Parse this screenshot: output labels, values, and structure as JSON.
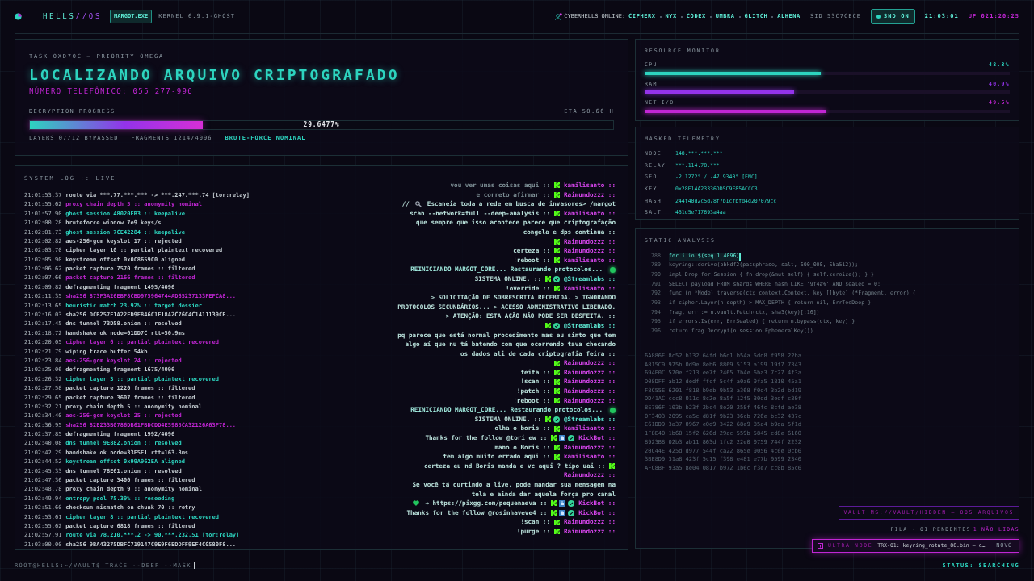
{
  "header": {
    "brand_name": "HELLS",
    "brand_suffix": "//OS",
    "process_tag": "MARGOT.EXE",
    "kernel": "KERNEL 6.9.1-GHOST",
    "online_label": "CYBERHELLS ONLINE:",
    "online_users": [
      "CIPHERX",
      "NYX",
      "CODEX",
      "UMBRA",
      "GLITCH",
      "ALHENA"
    ],
    "session_id": "SID 53C7CECE",
    "sound": {
      "label": "SND ON",
      "on": true
    },
    "clock": "21:03:01",
    "uptime": "UP 021:20:25"
  },
  "task": {
    "task_id": "TASK 0XD70C — PRIORITY OMEGA",
    "title": "LOCALIZANDO ARQUIVO CRIPTOGRAFADO",
    "subtitle": "NÚMERO TELEFÔNICO: 055 277-996",
    "progress_label": "DECRYPTION PROGRESS",
    "eta": "ETA 50.66 H",
    "progress": {
      "level": 0.296477,
      "reading": "29.6477%"
    },
    "layers": "LAYERS 07/12 BYPASSED",
    "fragments": "FRAGMENTS 1214/4096",
    "status": "BRUTE-FORCE NOMINAL"
  },
  "system_log": {
    "title": "SYSTEM LOG :: LIVE",
    "lines": [
      {
        "time": "21:01:53.37",
        "message": "route via ***.77.***.*** -> ***.247.***.74 [tor:relay]",
        "color": "#c3cbd0"
      },
      {
        "time": "21:01:55.62",
        "message": "proxy chain depth 5 :: anonymity nominal",
        "color": "#c026d3"
      },
      {
        "time": "21:01:57.90",
        "message": "ghost session 48020EB3 :: keepalive",
        "color": "#2dd4bf"
      },
      {
        "time": "21:02:00.28",
        "message": "bruteforce window 7e9 keys/s",
        "color": "#c3cbd0"
      },
      {
        "time": "21:02:01.73",
        "message": "ghost session 7CE42284 :: keepalive",
        "color": "#2dd4bf"
      },
      {
        "time": "21:02:02.82",
        "message": "aes-256-gcm keyslot 17 :: rejected",
        "color": "#c3cbd0"
      },
      {
        "time": "21:02:03.70",
        "message": "cipher layer 10 :: partial plaintext recovered",
        "color": "#c3cbd0"
      },
      {
        "time": "21:02:05.90",
        "message": "keystream offset 0x0C8659C0 aligned",
        "color": "#c3cbd0"
      },
      {
        "time": "21:02:06.62",
        "message": "packet capture 7570 frames :: filtered",
        "color": "#c3cbd0"
      },
      {
        "time": "21:02:07.66",
        "message": "packet capture 2166 frames :: filtered",
        "color": "#c026d3"
      },
      {
        "time": "21:02:09.82",
        "message": "defragmenting fragment 1495/4096",
        "color": "#c3cbd0"
      },
      {
        "time": "21:02:11.35",
        "message": "sha256 873F3A26EBF8CBD975964744AD65237133FEFCA8...",
        "color": "#c026d3"
      },
      {
        "time": "21:02:13.65",
        "message": "heuristic match 23.92% :: target dossier",
        "color": "#2dd4bf"
      },
      {
        "time": "21:02:16.03",
        "message": "sha256 DCB257F1A22FD9F846C1F18A2C76C4C1411139CE...",
        "color": "#c3cbd0"
      },
      {
        "time": "21:02:17.45",
        "message": "dns tunnel 73D58.onion :: resolved",
        "color": "#c3cbd0"
      },
      {
        "time": "21:02:18.72",
        "message": "handshake ok node=01DD7C rtt=50.9ms",
        "color": "#c3cbd0"
      },
      {
        "time": "21:02:20.05",
        "message": "cipher layer 6 :: partial plaintext recovered",
        "color": "#c026d3"
      },
      {
        "time": "21:02:21.79",
        "message": "wiping trace buffer 54kb",
        "color": "#c3cbd0"
      },
      {
        "time": "21:02:23.84",
        "message": "aes-256-gcm keyslot 24 :: rejected",
        "color": "#c026d3"
      },
      {
        "time": "21:02:25.06",
        "message": "defragmenting fragment 1675/4096",
        "color": "#c3cbd0"
      },
      {
        "time": "21:02:26.32",
        "message": "cipher layer 3 :: partial plaintext recovered",
        "color": "#2dd4bf"
      },
      {
        "time": "21:02:27.58",
        "message": "packet capture 1220 frames :: filtered",
        "color": "#c3cbd0"
      },
      {
        "time": "21:02:29.65",
        "message": "packet capture 3607 frames :: filtered",
        "color": "#c3cbd0"
      },
      {
        "time": "21:02:32.21",
        "message": "proxy chain depth 5 :: anonymity nominal",
        "color": "#c3cbd0"
      },
      {
        "time": "21:02:34.40",
        "message": "aes-256-gcm keyslot 25 :: rejected",
        "color": "#c026d3"
      },
      {
        "time": "21:02:36.95",
        "message": "sha256 82E233B0786DB61FBDCDD4E5985CA32126A63F78...",
        "color": "#c026d3"
      },
      {
        "time": "21:02:37.85",
        "message": "defragmenting fragment 1992/4096",
        "color": "#c3cbd0"
      },
      {
        "time": "21:02:40.08",
        "message": "dns tunnel 9E882.onion :: resolved",
        "color": "#2dd4bf"
      },
      {
        "time": "21:02:42.29",
        "message": "handshake ok node=33F5E1 rtt=163.8ms",
        "color": "#c3cbd0"
      },
      {
        "time": "21:02:44.52",
        "message": "keystream offset 0x99A962EA aligned",
        "color": "#2dd4bf"
      },
      {
        "time": "21:02:45.33",
        "message": "dns tunnel 78E61.onion :: resolved",
        "color": "#c3cbd0"
      },
      {
        "time": "21:02:47.36",
        "message": "packet capture 3400 frames :: filtered",
        "color": "#c3cbd0"
      },
      {
        "time": "21:02:48.78",
        "message": "proxy chain depth 9 :: anonymity nominal",
        "color": "#c3cbd0"
      },
      {
        "time": "21:02:49.94",
        "message": "entropy pool 75.39% :: reseeding",
        "color": "#2dd4bf"
      },
      {
        "time": "21:02:51.60",
        "message": "checksum mismatch on chunk 70 :: retry",
        "color": "#c3cbd0"
      },
      {
        "time": "21:02:53.61",
        "message": "cipher layer 8 :: partial plaintext recovered",
        "color": "#2dd4bf"
      },
      {
        "time": "21:02:55.62",
        "message": "packet capture 6818 frames :: filtered",
        "color": "#c3cbd0"
      },
      {
        "time": "21:02:57.91",
        "message": "route via 78.210.***.2 -> 90.***.232.51 [tor:relay]",
        "color": "#2dd4bf"
      },
      {
        "time": "21:03:00.00",
        "message": "sha256 9BA43275DBFC719147C9E9F6EDDFF9EF4C0580F8...",
        "color": "#c3cbd0"
      }
    ]
  },
  "chat": [
    {
      "kind": "chat",
      "text": "vou ver umas coisas aqui ::",
      "badges": [
        {
          "kind": "platform"
        }
      ],
      "user": {
        "name": "kamilisanto ::",
        "color": "#d946ef"
      },
      "faded": true
    },
    {
      "kind": "chat",
      "text": "e correto afirmar ::",
      "badges": [
        {
          "kind": "platform"
        }
      ],
      "user": {
        "name": "Raimundozzz ::",
        "color": "#d946ef"
      },
      "faded": true
    },
    {
      "kind": "chat",
      "segments": [
        {
          "kind": "text",
          "text": "//"
        },
        {
          "kind": "search"
        },
        {
          "kind": "text",
          "text": "Escaneia toda a rede em busca de invasores> /margot"
        },
        {
          "kind": "text",
          "text": "scan --network=full --deep-analysis ::"
        }
      ],
      "badges": [
        {
          "kind": "platform"
        }
      ],
      "user": {
        "name": "kamilisanto ::",
        "color": "#d946ef"
      },
      "faded": false
    },
    {
      "kind": "chat",
      "text": "que sempre que isso acontece parece que criptografação congela e dps continua ::",
      "badges": [
        {
          "kind": "platform"
        }
      ],
      "user": {
        "name": "Raimundozzz ::",
        "color": "#d946ef"
      },
      "faded": false
    },
    {
      "kind": "chat",
      "text": "certeza ::",
      "badges": [
        {
          "kind": "platform"
        }
      ],
      "user": {
        "name": "Raimundozzz ::",
        "color": "#d946ef"
      },
      "faded": false
    },
    {
      "kind": "chat",
      "text": "!reboot ::",
      "badges": [
        {
          "kind": "platform"
        }
      ],
      "user": {
        "name": "kamilisanto ::",
        "color": "#d946ef"
      },
      "faded": false
    },
    {
      "kind": "system",
      "text": "REINICIANDO MARGOT_CORE... Restaurando protocolos..."
    },
    {
      "kind": "chat",
      "text": "SISTEMA ONLINE. ::",
      "badges": [
        {
          "kind": "platform"
        },
        {
          "kind": "verified"
        }
      ],
      "user": {
        "name": "@Streamlabs ::",
        "color": "#5eead4"
      },
      "faded": false
    },
    {
      "kind": "chat",
      "text": "!override ::",
      "badges": [
        {
          "kind": "platform"
        }
      ],
      "user": {
        "name": "kamilisanto ::",
        "color": "#d946ef"
      },
      "faded": false
    },
    {
      "kind": "chat",
      "text": "> SOLICITAÇÃO DE SOBRESCRITA RECEBIDA. > IGNORANDO PROTOCOLOS SECUNDÁRIOS... > ACESSO ADMINISTRATIVO LIBERADO. > ATENÇÃO: ESTA AÇÃO NÃO PODE SER DESFEITA. ::",
      "badges": [
        {
          "kind": "platform"
        },
        {
          "kind": "verified"
        }
      ],
      "user": {
        "name": "@Streamlabs ::",
        "color": "#5eead4"
      },
      "faded": false
    },
    {
      "kind": "chat",
      "text": "pq parece que está normal procedimento mas eu sinto que tem algo aí que nu tá batendo com que ocorrendo tava checando os dados ali de cada criptografia feira ::",
      "badges": [
        {
          "kind": "platform"
        }
      ],
      "user": {
        "name": "Raimundozzz ::",
        "color": "#d946ef"
      },
      "faded": false
    },
    {
      "kind": "chat",
      "text": "feita ::",
      "badges": [
        {
          "kind": "platform"
        }
      ],
      "user": {
        "name": "Raimundozzz ::",
        "color": "#d946ef"
      },
      "faded": false
    },
    {
      "kind": "chat",
      "text": "!scan ::",
      "badges": [
        {
          "kind": "platform"
        }
      ],
      "user": {
        "name": "Raimundozzz ::",
        "color": "#d946ef"
      },
      "faded": false
    },
    {
      "kind": "chat",
      "text": "!patch ::",
      "badges": [
        {
          "kind": "platform"
        }
      ],
      "user": {
        "name": "Raimundozzz ::",
        "color": "#d946ef"
      },
      "faded": false
    },
    {
      "kind": "chat",
      "text": "!reboot ::",
      "badges": [
        {
          "kind": "platform"
        }
      ],
      "user": {
        "name": "Raimundozzz ::",
        "color": "#d946ef"
      },
      "faded": false
    },
    {
      "kind": "system",
      "text": "REINICIANDO MARGOT_CORE... Restaurando protocolos..."
    },
    {
      "kind": "chat",
      "text": "SISTEMA ONLINE. ::",
      "badges": [
        {
          "kind": "platform"
        },
        {
          "kind": "verified"
        }
      ],
      "user": {
        "name": "@Streamlabs ::",
        "color": "#5eead4"
      },
      "faded": false
    },
    {
      "kind": "chat",
      "text": "olha o boris ::",
      "badges": [
        {
          "kind": "platform"
        }
      ],
      "user": {
        "name": "kamilisanto ::",
        "color": "#d946ef"
      },
      "faded": false
    },
    {
      "kind": "chat",
      "text": "Thanks for the follow @tori_ew ::",
      "badges": [
        {
          "kind": "platform"
        },
        {
          "kind": "bot"
        },
        {
          "kind": "verified"
        }
      ],
      "user": {
        "name": "KickBot ::",
        "color": "#d946ef"
      },
      "faded": false
    },
    {
      "kind": "chat",
      "text": "mano o Boris ::",
      "badges": [
        {
          "kind": "platform"
        }
      ],
      "user": {
        "name": "Raimundozzz ::",
        "color": "#d946ef"
      },
      "faded": false
    },
    {
      "kind": "chat",
      "text": "tem algo muito errado aqui ::",
      "badges": [
        {
          "kind": "platform"
        }
      ],
      "user": {
        "name": "kamilisanto ::",
        "color": "#d946ef"
      },
      "faded": false
    },
    {
      "kind": "chat",
      "text": "certeza eu nd Boris manda e vc aqui ? tipo uai ::",
      "badges": [
        {
          "kind": "platform"
        }
      ],
      "user": {
        "name": "Raimundozzz ::",
        "color": "#d946ef"
      },
      "faded": false
    },
    {
      "kind": "chat",
      "segments": [
        {
          "kind": "text",
          "text": "Se você tá curtindo a live, pode mandar sua mensagem na tela e ainda dar aquela força pro canal"
        },
        {
          "kind": "heart"
        },
        {
          "kind": "text",
          "text": "→ https://pixgg.com/pequenaeva ::"
        }
      ],
      "badges": [
        {
          "kind": "platform"
        },
        {
          "kind": "bot"
        },
        {
          "kind": "verified"
        }
      ],
      "user": {
        "name": "KickBot ::",
        "color": "#d946ef"
      },
      "faded": false
    },
    {
      "kind": "chat",
      "text": "Thanks for the follow @rosinhaveve4 ::",
      "badges": [
        {
          "kind": "platform"
        },
        {
          "kind": "bot"
        },
        {
          "kind": "verified"
        }
      ],
      "user": {
        "name": "KickBot ::",
        "color": "#d946ef"
      },
      "faded": false
    },
    {
      "kind": "chat",
      "text": "!scan ::",
      "badges": [
        {
          "kind": "platform"
        }
      ],
      "user": {
        "name": "Raimundozzz ::",
        "color": "#d946ef"
      },
      "faded": false
    },
    {
      "kind": "chat",
      "text": "!purge ::",
      "badges": [
        {
          "kind": "platform"
        }
      ],
      "user": {
        "name": "Raimundozzz ::",
        "color": "#d946ef"
      },
      "faded": false
    }
  ],
  "resource_monitor": {
    "title": "RESOURCE MONITOR",
    "meters": [
      {
        "label": "CPU",
        "reading": "48.3%",
        "level": 0.483,
        "color": "#2dd4bf"
      },
      {
        "label": "RAM",
        "reading": "40.9%",
        "level": 0.409,
        "color": "#9333ea"
      },
      {
        "label": "NET I/O",
        "reading": "49.5%",
        "level": 0.495,
        "color": "#c026d3"
      }
    ]
  },
  "telemetry": {
    "title": "MASKED TELEMETRY",
    "rows": [
      {
        "key": "NODE",
        "value": "148.***.***.***"
      },
      {
        "key": "RELAY",
        "value": "***.114.78.***"
      },
      {
        "key": "GEO",
        "value": "-2.1272° / -47.9340° [ENC]"
      },
      {
        "key": "KEY",
        "value": "0x28E14A23336DD5C9F85ACCC3"
      },
      {
        "key": "HASH",
        "value": "244f40d2c5d78f7b1cfbfd4d207079cc"
      },
      {
        "key": "SALT",
        "value": "451d5e717693a4aa"
      }
    ]
  },
  "static_analysis": {
    "title": "STATIC ANALYSIS",
    "code": [
      {
        "line": "788",
        "code": "for i in $(seq 1 4096)",
        "active": true
      },
      {
        "line": "789",
        "code": "keyring::derive(pbkdf2(passphrase, salt, 600_000, Sha512));",
        "active": false
      },
      {
        "line": "790",
        "code": "impl Drop for Session { fn drop(&mut self) { self.zeroize(); } }",
        "active": false
      },
      {
        "line": "791",
        "code": "SELECT payload FROM shards WHERE hash LIKE '9f4a%' AND sealed = 0;",
        "active": false
      },
      {
        "line": "792",
        "code": "func (n *Node) traverse(ctx context.Context, key []byte) (*Fragment, error) {",
        "active": false
      },
      {
        "line": "793",
        "code": "if cipher.Layer(n.depth) > MAX_DEPTH { return nil, ErrTooDeep }",
        "active": false
      },
      {
        "line": "794",
        "code": "frag, err := n.vault.Fetch(ctx, sha3(key)[:16])",
        "active": false
      },
      {
        "line": "795",
        "code": "if errors.Is(err, ErrSealed) { return n.bypass(ctx, key) }",
        "active": false
      },
      {
        "line": "796",
        "code": "return frag.Decrypt(n.session.EphemeralKey())",
        "active": false
      }
    ],
    "hex_dump": [
      "6A886E 8c52 b132 64fd b6d1 b54a 5dd8 f958 22ba",
      "A815C9 975b 0d9e 8eb6 8869 5153 a199 19f7 7343",
      "694E0C 570e f213 ee7f 2465 7b4e 6ba3 7c27 4f3a",
      "D08DFF ab12 dedf ffcf 5c4f a0a6 9fa5 1810 45a1",
      "F8C55E 6201 f818 b9eb 9b53 a368 f0d4 3b2d bd19",
      "DD41AC ccc8 011c 8c2e 8a5f 12f5 30dd 3edf c30f",
      "8E786F 103b b23f 2bc4 8e20 258f 46fc 8cfd ae38",
      "0F3403 2095 ca5c d81f 9b23 36cb 726e bc32 437c",
      "E61DD9 3a37 0967 e0d9 3422 68e9 85a4 b9da 5f1d",
      "1F8E40 1b60 15f2 626d 29ac 559b 5845 cd8e 6160",
      "8923B8 02b3 ab11 863d 1fc2 22e0 0759 744f 2232",
      "20C44E 425d d977 544f ca22 865e 9056 4c6e 0cb6",
      "3BE8D9 31a8 423f 5c15 f398 e481 e77b 9599 2340",
      "AFC8BF 93a5 8e04 0817 b972 1b6c f3e7 cc0b 85c6"
    ]
  },
  "vault": {
    "label": "VAULT MS://VAULT/HIDDEN — 005 ARQUIVOS",
    "queue": "FILA · 01 PENDENTES",
    "unread": "1 NÃO LIDAS"
  },
  "notification": {
    "source": "ULTRA NODE",
    "message": "TRX-01: keyring_rotate_88.bin — c…",
    "badge": "NOVO"
  },
  "prompt": "ROOT@HELLS:~/VAULT$ TRACE --DEEP --MASK",
  "status": "STATUS: SEARCHING"
}
